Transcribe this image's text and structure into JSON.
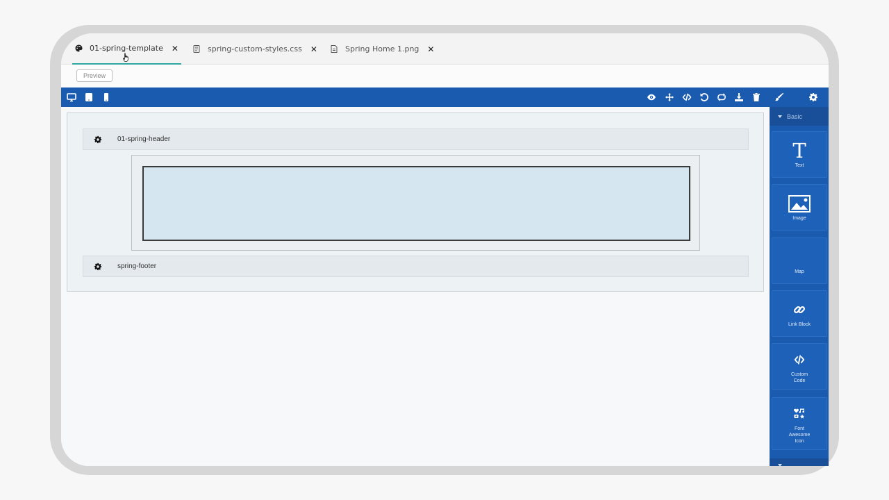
{
  "tabs": [
    {
      "label": "01-spring-template",
      "icon": "palette-icon",
      "active": true
    },
    {
      "label": "spring-custom-styles.css",
      "icon": "css-file-icon",
      "active": false
    },
    {
      "label": "Spring Home 1.png",
      "icon": "image-file-icon",
      "active": false
    }
  ],
  "preview_label": "Preview",
  "toolbar": {
    "left_icons": [
      "desktop-icon",
      "tablet-icon",
      "mobile-icon"
    ],
    "right_icons": [
      "eye-icon",
      "move-icon",
      "code-icon",
      "undo-icon",
      "redo-icon",
      "download-icon",
      "trash-icon",
      "paint-brush-icon",
      "gear-icon"
    ],
    "color": "#1a5bb0"
  },
  "canvas": {
    "header_label": "01-spring-header",
    "footer_label": "spring-footer"
  },
  "panel": {
    "section_label": "Basic",
    "blocks": [
      {
        "label": "Text",
        "icon": "text-icon"
      },
      {
        "label": "Image",
        "icon": "image-icon"
      },
      {
        "label": "Map",
        "icon": "map-icon"
      },
      {
        "label": "Link Block",
        "icon": "link-icon"
      },
      {
        "label": "Custom Code",
        "icon": "code-icon"
      },
      {
        "label": "Font Awesome Icon",
        "icon": "font-awesome-icon"
      }
    ]
  }
}
